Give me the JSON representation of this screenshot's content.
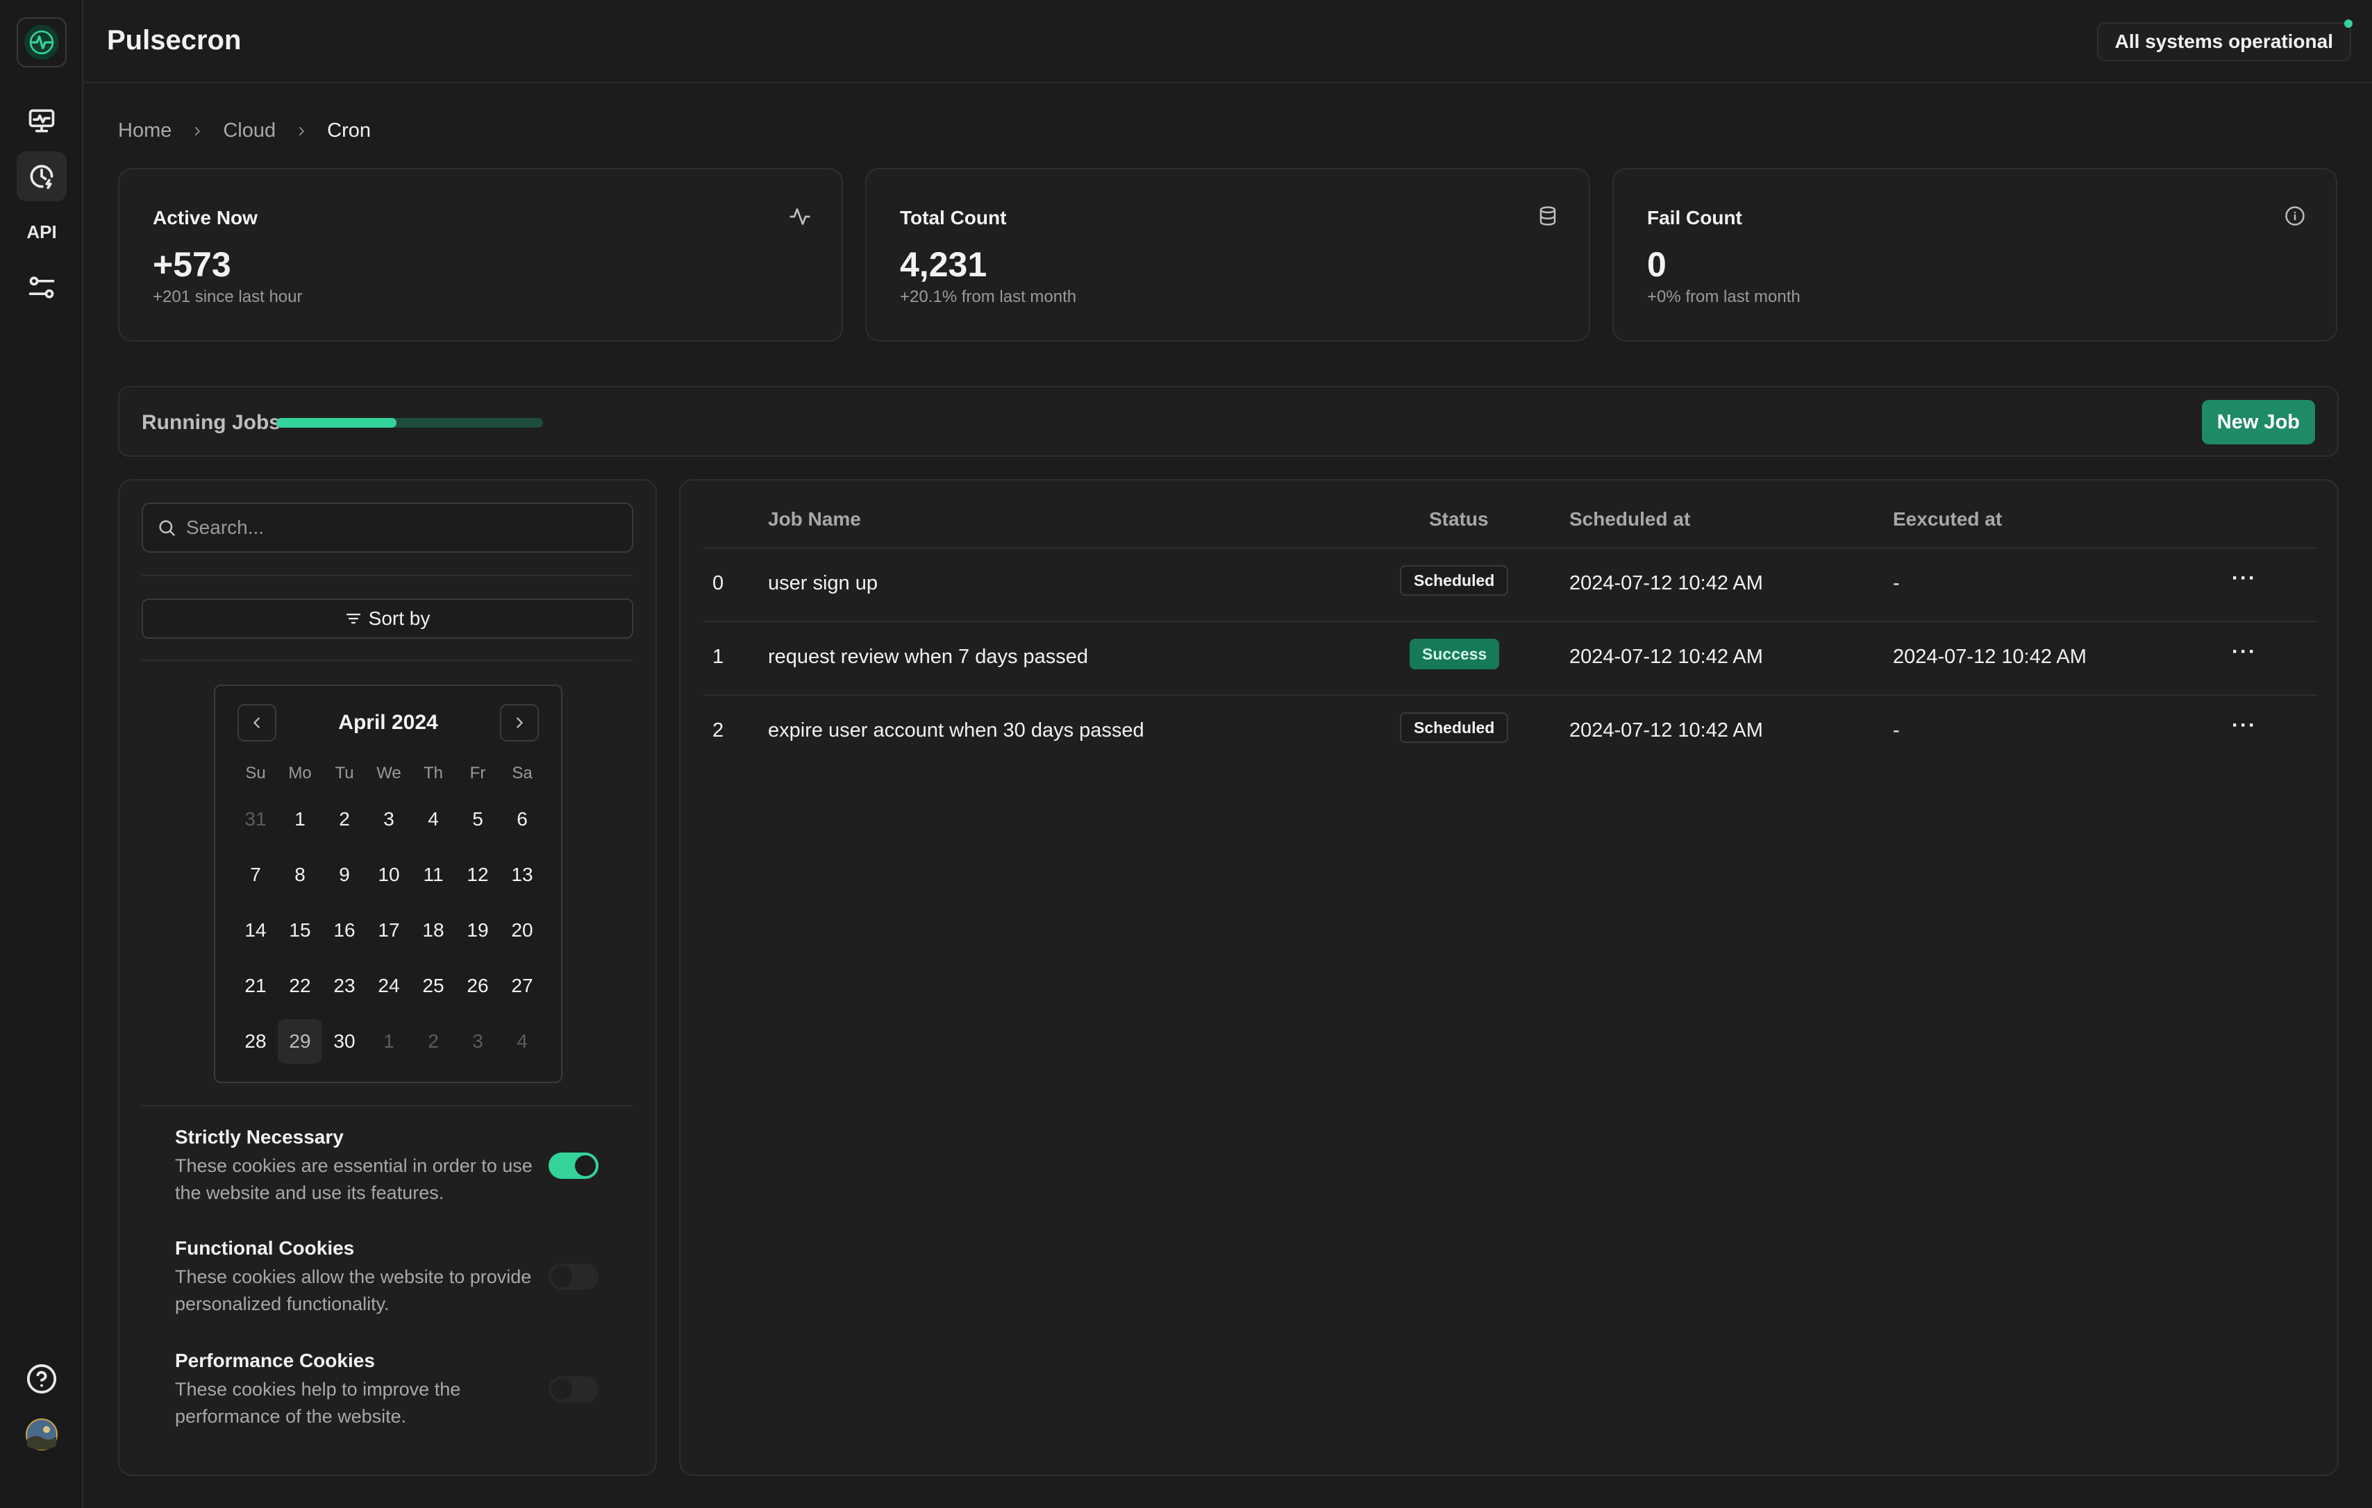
{
  "app": {
    "title": "Pulsecron",
    "status": "All systems operational"
  },
  "sidebar": {
    "items": [
      {
        "name": "monitor-icon"
      },
      {
        "name": "clock-icon"
      },
      {
        "name": "api",
        "label": "API"
      },
      {
        "name": "settings-sliders-icon"
      }
    ],
    "bottom": [
      {
        "name": "help-icon"
      },
      {
        "name": "avatar"
      }
    ]
  },
  "breadcrumb": [
    "Home",
    "Cloud",
    "Cron"
  ],
  "stats": [
    {
      "label": "Active Now",
      "value": "+573",
      "sub": "+201 since last hour",
      "icon": "activity-icon"
    },
    {
      "label": "Total Count",
      "value": "4,231",
      "sub": "+20.1% from last month",
      "icon": "database-icon"
    },
    {
      "label": "Fail Count",
      "value": "0",
      "sub": "+0% from last month",
      "icon": "info-icon"
    }
  ],
  "running": {
    "label": "Running Jobs",
    "progress": 0.45
  },
  "actions": {
    "new_job": "New Job"
  },
  "search": {
    "placeholder": "Search..."
  },
  "sort": {
    "label": "Sort by"
  },
  "calendar": {
    "month": "April 2024",
    "weekdays": [
      "Su",
      "Mo",
      "Tu",
      "We",
      "Th",
      "Fr",
      "Sa"
    ],
    "weeks": [
      [
        "31",
        "1",
        "2",
        "3",
        "4",
        "5",
        "6"
      ],
      [
        "7",
        "8",
        "9",
        "10",
        "11",
        "12",
        "13"
      ],
      [
        "14",
        "15",
        "16",
        "17",
        "18",
        "19",
        "20"
      ],
      [
        "21",
        "22",
        "23",
        "24",
        "25",
        "26",
        "27"
      ],
      [
        "28",
        "29",
        "30",
        "1",
        "2",
        "3",
        "4"
      ]
    ]
  },
  "cookies": [
    {
      "title": "Strictly Necessary",
      "desc": "These cookies are essential in order to use the website and use its features.",
      "on": true
    },
    {
      "title": "Functional Cookies",
      "desc": "These cookies allow the website to provide personalized functionality.",
      "on": false
    },
    {
      "title": "Performance Cookies",
      "desc": "These cookies help to improve the performance of the website.",
      "on": false
    }
  ],
  "table": {
    "columns": [
      "Job Name",
      "Status",
      "Scheduled at",
      "Eexcuted at"
    ],
    "rows": [
      {
        "id": "0",
        "name": "user sign up",
        "status": "Scheduled",
        "scheduled": "2024-07-12 10:42 AM",
        "executed": "-"
      },
      {
        "id": "1",
        "name": "request review when 7 days passed",
        "status": "Success",
        "scheduled": "2024-07-12 10:42 AM",
        "executed": "2024-07-12 10:42 AM"
      },
      {
        "id": "2",
        "name": "expire user account when 30 days passed",
        "status": "Scheduled",
        "scheduled": "2024-07-12 10:42 AM",
        "executed": "-"
      }
    ],
    "row_menu": "···"
  },
  "colors": {
    "accent": "#34d399",
    "button": "#1e8a66",
    "background": "#1c1c1d"
  }
}
